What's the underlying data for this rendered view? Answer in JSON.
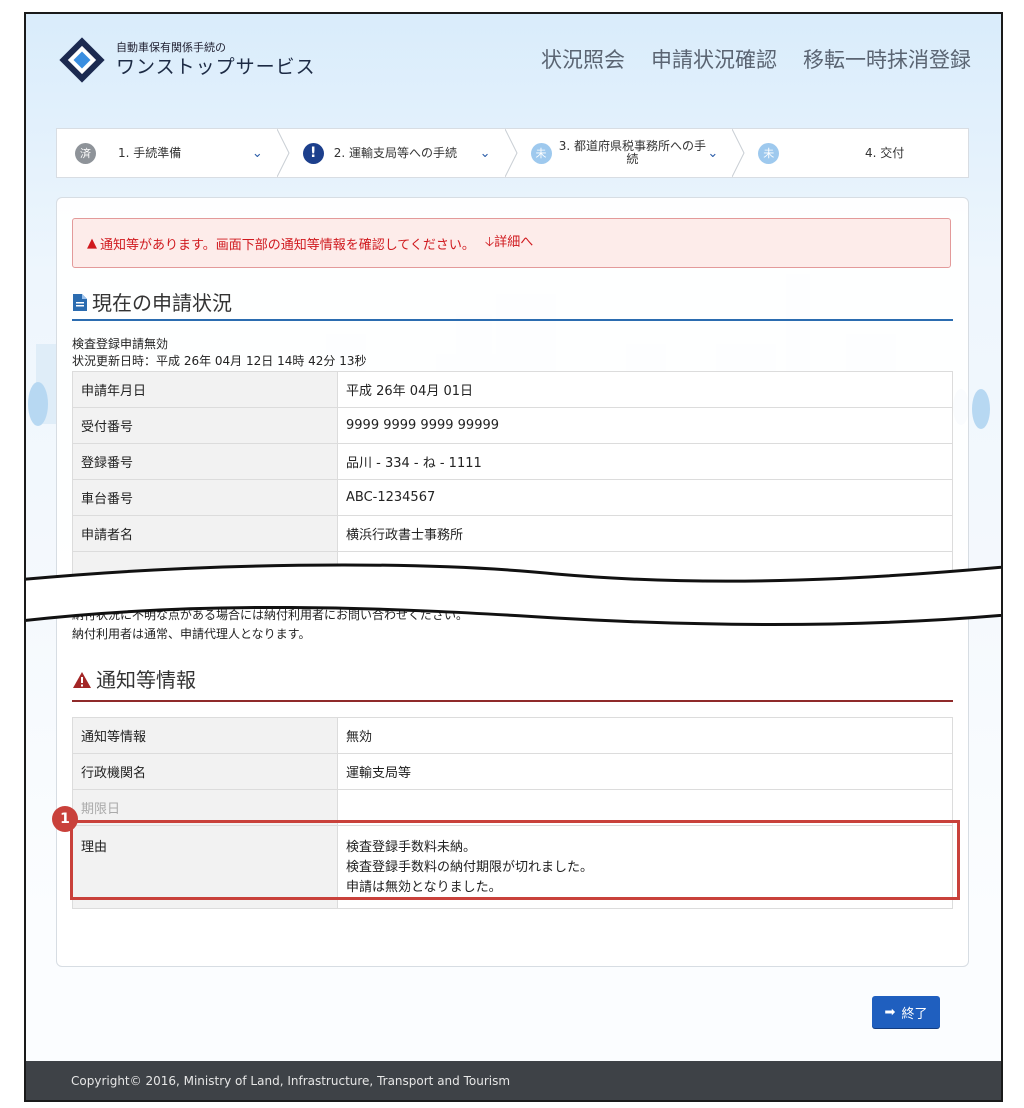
{
  "header": {
    "logo_small": "自動車保有関係手続の",
    "logo_big": "ワンストップサービス",
    "nav": [
      "状況照会",
      "申請状況確認",
      "移転一時抹消登録"
    ]
  },
  "steps": [
    {
      "badge": "済",
      "label": "1. 手続準備",
      "state": "done"
    },
    {
      "badge": "!",
      "label": "2. 運輸支局等への手続",
      "state": "alert"
    },
    {
      "badge": "未",
      "label": "3. 都道府県税事務所への手続",
      "state": "todo"
    },
    {
      "badge": "未",
      "label": "4. 交付",
      "state": "todo"
    }
  ],
  "alert": {
    "message": "通知等があります。画面下部の通知等情報を確認してください。",
    "link": "詳細へ"
  },
  "status_section": {
    "title": "現在の申請状況",
    "status_text": "検査登録申請無効",
    "updated": "状況更新日時：平成 26年 04月 12日 14時 42分 13秒",
    "rows": [
      {
        "key": "申請年月日",
        "value": "平成 26年 04月 01日"
      },
      {
        "key": "受付番号",
        "value": "9999 9999 9999 99999"
      },
      {
        "key": "登録番号",
        "value": "品川 - 334 - ね - 1111"
      },
      {
        "key": "車台番号",
        "value": "ABC-1234567"
      },
      {
        "key": "申請者名",
        "value": "横浜行政書士事務所"
      }
    ],
    "notes": [
      "納付状況に不明な点がある場合には納付利用者にお問い合わせください。",
      "納付利用者は通常、申請代理人となります。"
    ]
  },
  "notice_section": {
    "title": "通知等情報",
    "rows": [
      {
        "key": "通知等情報",
        "value": "無効"
      },
      {
        "key": "行政機関名",
        "value": "運輸支局等"
      },
      {
        "key": "期限日",
        "value": ""
      },
      {
        "key": "理由",
        "value_lines": [
          "検査登録手数料未納。",
          "検査登録手数料の納付期限が切れました。",
          "申請は無効となりました。"
        ]
      }
    ]
  },
  "annotation_number": "1",
  "end_button": "終了",
  "footer": "Copyright© 2016, Ministry of Land, Infrastructure, Transport and Tourism",
  "colors": {
    "accent_blue": "#1f5fbf",
    "alert_red": "#d0191e",
    "highlight": "#c9413b"
  }
}
